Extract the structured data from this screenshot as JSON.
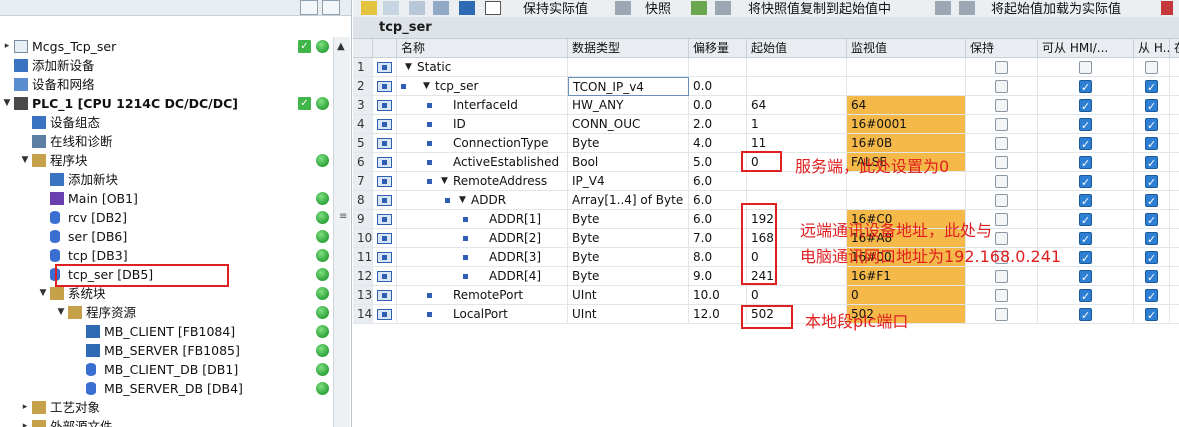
{
  "left_panel": {
    "tree": [
      {
        "label": "Mcgs_Tcp_ser",
        "icon": "project-file-icon",
        "expand": "▸",
        "check": true,
        "dot": true
      },
      {
        "label": "添加新设备",
        "icon": "add-device-icon",
        "expand": "",
        "check": false,
        "dot": false
      },
      {
        "label": "设备和网络",
        "icon": "network-icon",
        "expand": "",
        "check": false,
        "dot": false
      },
      {
        "label": "PLC_1 [CPU 1214C DC/DC/DC]",
        "icon": "plc-icon",
        "expand": "▼",
        "check": true,
        "dot": true
      },
      {
        "label": "设备组态",
        "icon": "device-config-icon",
        "expand": "",
        "check": false,
        "dot": false
      },
      {
        "label": "在线和诊断",
        "icon": "online-diag-icon",
        "expand": "",
        "check": false,
        "dot": false
      },
      {
        "label": "程序块",
        "icon": "folder-icon",
        "expand": "▼",
        "check": false,
        "dot": true
      },
      {
        "label": "添加新块",
        "icon": "add-block-icon",
        "expand": "",
        "check": false,
        "dot": false
      },
      {
        "label": "Main [OB1]",
        "icon": "ob-block-icon",
        "expand": "",
        "check": false,
        "dot": true
      },
      {
        "label": "rcv [DB2]",
        "icon": "db-cylinder-icon",
        "expand": "",
        "check": false,
        "dot": true
      },
      {
        "label": "ser [DB6]",
        "icon": "db-cylinder-icon",
        "expand": "",
        "check": false,
        "dot": true
      },
      {
        "label": "tcp [DB3]",
        "icon": "db-cylinder-icon",
        "expand": "",
        "check": false,
        "dot": true
      },
      {
        "label": "tcp_ser [DB5]",
        "icon": "db-cylinder-icon",
        "expand": "",
        "check": false,
        "dot": true,
        "selected": true
      },
      {
        "label": "系统块",
        "icon": "folder-icon",
        "expand": "▼",
        "check": false,
        "dot": true
      },
      {
        "label": "程序资源",
        "icon": "folder-icon",
        "expand": "▼",
        "check": false,
        "dot": true
      },
      {
        "label": "MB_CLIENT [FB1084]",
        "icon": "fb-block-icon",
        "expand": "",
        "check": false,
        "dot": true
      },
      {
        "label": "MB_SERVER [FB1085]",
        "icon": "fb-block-icon",
        "expand": "",
        "check": false,
        "dot": true
      },
      {
        "label": "MB_CLIENT_DB [DB1]",
        "icon": "db-cylinder-icon",
        "expand": "",
        "check": false,
        "dot": true
      },
      {
        "label": "MB_SERVER_DB [DB4]",
        "icon": "db-cylinder-icon",
        "expand": "",
        "check": false,
        "dot": true
      },
      {
        "label": "工艺对象",
        "icon": "folder-icon",
        "expand": "▸",
        "check": false,
        "dot": false
      },
      {
        "label": "外部源文件",
        "icon": "folder-icon",
        "expand": "▸",
        "check": false,
        "dot": false
      }
    ]
  },
  "toolbar": {
    "keep_actual": "保持实际值",
    "snapshot": "快照",
    "copy_snapshot": "将快照值复制到起始值中",
    "load_start": "将起始值加载为实际值"
  },
  "db_title": "tcp_ser",
  "columns": {
    "name": "名称",
    "datatype": "数据类型",
    "offset": "偏移量",
    "start": "起始值",
    "monitor": "监视值",
    "retain": "保持",
    "hmi1": "可从 HMI/...",
    "hmi2": "从 H...",
    "extra": "在"
  },
  "rows": [
    {
      "n": "1",
      "name": "Static",
      "dtype": "",
      "offset": "",
      "start": "",
      "monitor": "",
      "indent": 0,
      "tri": "▼",
      "marker": false,
      "retain": false,
      "h1": false,
      "h2": false
    },
    {
      "n": "2",
      "name": "tcp_ser",
      "dtype": "TCON_IP_v4",
      "offset": "0.0",
      "start": "",
      "monitor": "",
      "indent": 1,
      "tri": "▼",
      "marker": true,
      "retain": false,
      "h1": true,
      "h2": true
    },
    {
      "n": "3",
      "name": "InterfaceId",
      "dtype": "HW_ANY",
      "offset": "0.0",
      "start": "64",
      "monitor": "64",
      "indent": 2,
      "tri": "",
      "marker": true,
      "retain": false,
      "h1": true,
      "h2": true
    },
    {
      "n": "4",
      "name": "ID",
      "dtype": "CONN_OUC",
      "offset": "2.0",
      "start": "1",
      "monitor": "16#0001",
      "indent": 2,
      "tri": "",
      "marker": true,
      "retain": false,
      "h1": true,
      "h2": true
    },
    {
      "n": "5",
      "name": "ConnectionType",
      "dtype": "Byte",
      "offset": "4.0",
      "start": "11",
      "monitor": "16#0B",
      "indent": 2,
      "tri": "",
      "marker": true,
      "retain": false,
      "h1": true,
      "h2": true
    },
    {
      "n": "6",
      "name": "ActiveEstablished",
      "dtype": "Bool",
      "offset": "5.0",
      "start": "0",
      "monitor": "FALSE",
      "indent": 2,
      "tri": "",
      "marker": true,
      "retain": false,
      "h1": true,
      "h2": true
    },
    {
      "n": "7",
      "name": "RemoteAddress",
      "dtype": "IP_V4",
      "offset": "6.0",
      "start": "",
      "monitor": "",
      "indent": 2,
      "tri": "▼",
      "marker": true,
      "retain": false,
      "h1": true,
      "h2": true
    },
    {
      "n": "8",
      "name": "ADDR",
      "dtype": "Array[1..4] of Byte",
      "offset": "6.0",
      "start": "",
      "monitor": "",
      "indent": 3,
      "tri": "▼",
      "marker": true,
      "retain": false,
      "h1": true,
      "h2": true
    },
    {
      "n": "9",
      "name": "ADDR[1]",
      "dtype": "Byte",
      "offset": "6.0",
      "start": "192",
      "monitor": "16#C0",
      "indent": 4,
      "tri": "",
      "marker": true,
      "retain": false,
      "h1": true,
      "h2": true
    },
    {
      "n": "10",
      "name": "ADDR[2]",
      "dtype": "Byte",
      "offset": "7.0",
      "start": "168",
      "monitor": "16#A8",
      "indent": 4,
      "tri": "",
      "marker": true,
      "retain": false,
      "h1": true,
      "h2": true
    },
    {
      "n": "11",
      "name": "ADDR[3]",
      "dtype": "Byte",
      "offset": "8.0",
      "start": "0",
      "monitor": "16#00",
      "indent": 4,
      "tri": "",
      "marker": true,
      "retain": false,
      "h1": true,
      "h2": true
    },
    {
      "n": "12",
      "name": "ADDR[4]",
      "dtype": "Byte",
      "offset": "9.0",
      "start": "241",
      "monitor": "16#F1",
      "indent": 4,
      "tri": "",
      "marker": true,
      "retain": false,
      "h1": true,
      "h2": true
    },
    {
      "n": "13",
      "name": "RemotePort",
      "dtype": "UInt",
      "offset": "10.0",
      "start": "0",
      "monitor": "0",
      "indent": 2,
      "tri": "",
      "marker": true,
      "retain": false,
      "h1": true,
      "h2": true
    },
    {
      "n": "14",
      "name": "LocalPort",
      "dtype": "UInt",
      "offset": "12.0",
      "start": "502",
      "monitor": "502",
      "indent": 2,
      "tri": "",
      "marker": true,
      "retain": false,
      "h1": true,
      "h2": true
    }
  ],
  "annotations": {
    "server_note": "服务端，此处设置为0",
    "remote_note_1": "远端通讯设备地址，此处与",
    "remote_note_2": "电脑通讯网口地址为192.168.0.241",
    "local_note": "本地段plc端口"
  },
  "colors": {
    "monitor_fill": "#f5b94a",
    "annotation_red": "#e02020",
    "status_green": "#2fa23a"
  }
}
